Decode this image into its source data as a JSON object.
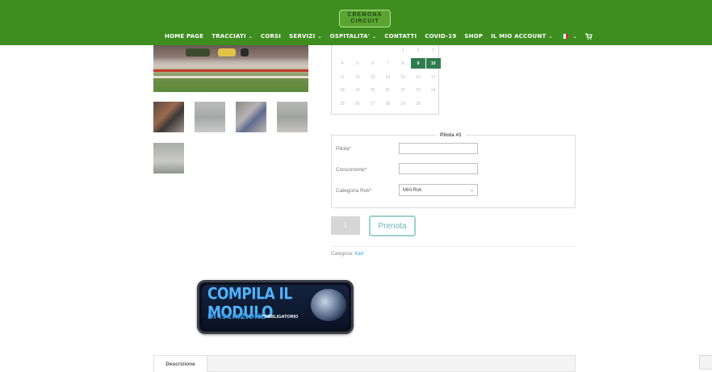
{
  "header": {
    "logo_line1": "CREMONA",
    "logo_line2": "CIRCUIT",
    "nav": [
      {
        "label": "HOME PAGE",
        "has_dropdown": false
      },
      {
        "label": "TRACCIATI",
        "has_dropdown": true
      },
      {
        "label": "CORSI",
        "has_dropdown": false
      },
      {
        "label": "SERVIZI",
        "has_dropdown": true
      },
      {
        "label": "OSPITALITA'",
        "has_dropdown": true
      },
      {
        "label": "CONTATTI",
        "has_dropdown": false
      },
      {
        "label": "COVID-19",
        "has_dropdown": false
      },
      {
        "label": "SHOP",
        "has_dropdown": false
      },
      {
        "label": "IL MIO ACCOUNT",
        "has_dropdown": true
      }
    ],
    "language_flag": "italian-flag-icon",
    "cart_icon": "cart-icon",
    "colors": {
      "header_bg": "#3e8e1f",
      "nav_text": "#ffffff"
    }
  },
  "calendar": {
    "rows": [
      [
        "",
        "",
        "",
        "",
        "1",
        "2",
        "3"
      ],
      [
        "4",
        "5",
        "6",
        "7",
        "8",
        "9",
        "10"
      ],
      [
        "11",
        "12",
        "13",
        "14",
        "15",
        "16",
        "17"
      ],
      [
        "18",
        "19",
        "20",
        "21",
        "22",
        "23",
        "24"
      ],
      [
        "25",
        "26",
        "27",
        "28",
        "29",
        "30",
        ""
      ]
    ],
    "selected_days": [
      "9",
      "10"
    ],
    "selected_color": "#2e7d4f"
  },
  "form": {
    "legend": "Pilota #1",
    "fields": [
      {
        "label": "Pilota",
        "value": ""
      },
      {
        "label": "Concorrente",
        "value": ""
      }
    ],
    "category": {
      "label": "Categoria Rok",
      "selected": "Mini Rok"
    },
    "required_marker": "*"
  },
  "purchase": {
    "quantity": "1",
    "button_label": "Prenota",
    "category_label": "Categoria:",
    "category_value": "Kart"
  },
  "banner": {
    "line1": "COMPILA IL MODULO",
    "line2": "DI ISCRIZIONE",
    "line3": "*OBBLIGATORIO"
  },
  "tabs": [
    {
      "label": "Descrizione",
      "active": true
    }
  ]
}
